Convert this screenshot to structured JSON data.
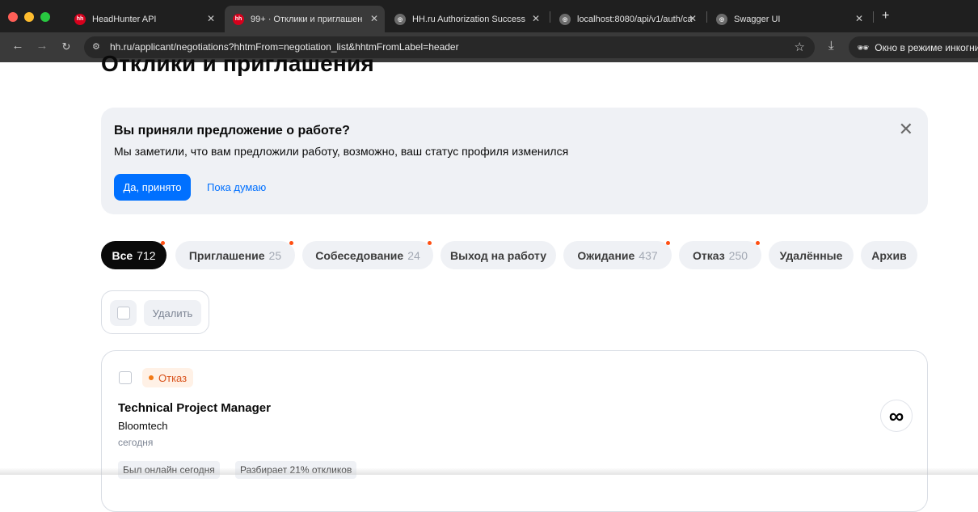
{
  "browser": {
    "tabs": [
      {
        "title": "HeadHunter API",
        "favicon": "hh-logo-icon",
        "active": false
      },
      {
        "title": "99+ · Отклики и приглашен",
        "favicon": "hh-logo-icon",
        "active": true
      },
      {
        "title": "HH.ru Authorization Success",
        "favicon": "globe-icon",
        "active": false
      },
      {
        "title": "localhost:8080/api/v1/auth/ca",
        "favicon": "globe-icon",
        "active": false
      },
      {
        "title": "Swagger UI",
        "favicon": "globe-icon",
        "active": false
      }
    ],
    "url": "hh.ru/applicant/negotiations?hhtmFrom=negotiation_list&hhtmFromLabel=header",
    "incognito_label": "Окно в режиме инкогни",
    "colors": {
      "chrome_dark": "#1f1f1f",
      "chrome_toolbar": "#3a3a3a",
      "hh_red": "#d6001c"
    }
  },
  "page": {
    "title": "Отклики и приглашения"
  },
  "banner": {
    "title": "Вы приняли предложение о работе?",
    "text": "Мы заметили, что вам предложили работу, возможно, ваш статус профиля изменился",
    "accept_label": "Да, принято",
    "later_label": "Пока думаю"
  },
  "filters": [
    {
      "label": "Все",
      "count": "712",
      "active": true,
      "dot": true
    },
    {
      "label": "Приглашение",
      "count": "25",
      "active": false,
      "dot": true
    },
    {
      "label": "Собеседование",
      "count": "24",
      "active": false,
      "dot": true
    },
    {
      "label": "Выход на работу",
      "count": "",
      "active": false,
      "dot": false
    },
    {
      "label": "Ожидание",
      "count": "437",
      "active": false,
      "dot": true
    },
    {
      "label": "Отказ",
      "count": "250",
      "active": false,
      "dot": true
    },
    {
      "label": "Удалённые",
      "count": "",
      "active": false,
      "dot": false
    },
    {
      "label": "Архив",
      "count": "",
      "active": false,
      "dot": false
    }
  ],
  "bulk": {
    "delete_label": "Удалить"
  },
  "card": {
    "status": "Отказ",
    "vacancy_title": "Technical Project Manager",
    "company": "Bloomtech",
    "date": "сегодня",
    "tags": [
      "Был онлайн сегодня",
      "Разбирает 21% откликов"
    ],
    "logo_glyph": "∞"
  },
  "colors": {
    "accent": "#0070ff",
    "chip_bg": "#eff1f5",
    "notify_dot": "#ff4f12",
    "status_refusal": "#f27a16"
  }
}
